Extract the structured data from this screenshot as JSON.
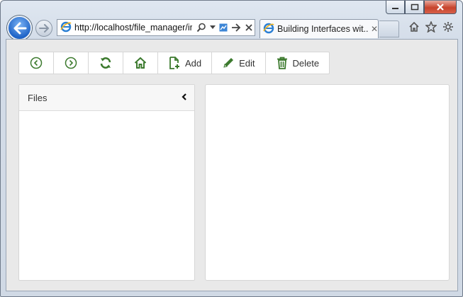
{
  "browser": {
    "address_url": "http://localhost/file_manager/ir",
    "tab_title": "Building Interfaces wit...",
    "tab_close_glyph": "✕",
    "accent": "#1f64c7"
  },
  "toolbar": {
    "add_label": "Add",
    "edit_label": "Edit",
    "delete_label": "Delete",
    "icon_color": "#3c7a2e"
  },
  "files": {
    "header": "Files",
    "collapse_glyph": "‹"
  }
}
